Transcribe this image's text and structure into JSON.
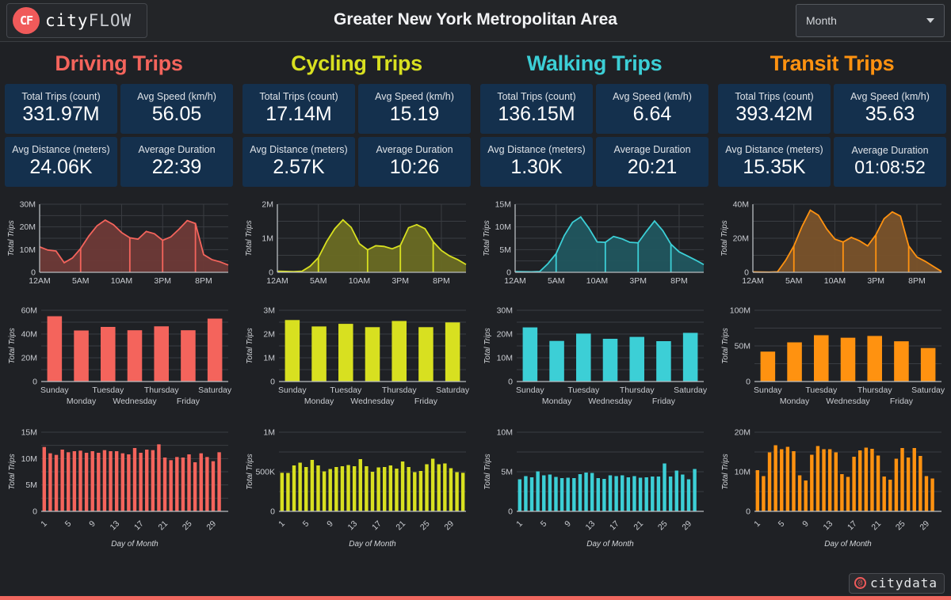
{
  "header": {
    "logo": {
      "badge": "CF",
      "text_part1": "city",
      "text_part2": "FLOW",
      "icon": "cityflow-logo-icon"
    },
    "title": "Greater New York Metropolitan Area",
    "period_selector": {
      "value": "Month",
      "icon": "chevron-down-icon"
    }
  },
  "footer": {
    "brand": "citydata",
    "icon": "at-circle-icon"
  },
  "columns": [
    {
      "title": "Driving Trips",
      "color": "#f4645c",
      "fill": "#6e3a37",
      "stats": [
        {
          "label": "Total Trips (count)",
          "value": "331.97M"
        },
        {
          "label": "Avg Speed (km/h)",
          "value": "56.05"
        },
        {
          "label": "Avg Distance (meters)",
          "value": "24.06K"
        },
        {
          "label": "Average Duration",
          "value": "22:39"
        }
      ]
    },
    {
      "title": "Cycling Trips",
      "color": "#d8e020",
      "fill": "#6a6c23",
      "stats": [
        {
          "label": "Total Trips (count)",
          "value": "17.14M"
        },
        {
          "label": "Avg Speed (km/h)",
          "value": "15.19"
        },
        {
          "label": "Avg Distance (meters)",
          "value": "2.57K"
        },
        {
          "label": "Average Duration",
          "value": "10:26"
        }
      ]
    },
    {
      "title": "Walking Trips",
      "color": "#3ccfd6",
      "fill": "#21565e",
      "stats": [
        {
          "label": "Total Trips (count)",
          "value": "136.15M"
        },
        {
          "label": "Avg Speed (km/h)",
          "value": "6.64"
        },
        {
          "label": "Avg Distance (meters)",
          "value": "1.30K"
        },
        {
          "label": "Average Duration",
          "value": "20:21"
        }
      ]
    },
    {
      "title": "Transit Trips",
      "color": "#ff9210",
      "fill": "#7a532a",
      "stats": [
        {
          "label": "Total Trips (count)",
          "value": "393.42M"
        },
        {
          "label": "Avg Speed (km/h)",
          "value": "35.63"
        },
        {
          "label": "Avg Distance (meters)",
          "value": "15.35K"
        },
        {
          "label": "Average Duration",
          "value": "01:08:52"
        }
      ]
    }
  ],
  "chart_data": [
    {
      "id": "driving-hourly",
      "type": "area",
      "title": "",
      "xlabel": "",
      "ylabel": "Total Trips",
      "grid": true,
      "color": "#f4645c",
      "fill": "#6e3a37",
      "x": [
        "12AM",
        "1AM",
        "2AM",
        "3AM",
        "4AM",
        "5AM",
        "6AM",
        "7AM",
        "8AM",
        "9AM",
        "10AM",
        "11AM",
        "12PM",
        "1PM",
        "2PM",
        "3PM",
        "4PM",
        "5PM",
        "6PM",
        "7PM",
        "8PM",
        "9PM",
        "10PM",
        "11PM"
      ],
      "xtick_labels": [
        "12AM",
        "5AM",
        "10AM",
        "3PM",
        "8PM"
      ],
      "xtick_indices": [
        0,
        5,
        10,
        15,
        20
      ],
      "ytick_labels": [
        "0",
        "10M",
        "20M",
        "30M"
      ],
      "ytick_values": [
        0,
        10000000,
        20000000,
        30000000
      ],
      "ylim": [
        0,
        30000000
      ],
      "values": [
        11200000,
        9800000,
        9400000,
        4200000,
        6300000,
        10500000,
        16000000,
        20500000,
        23000000,
        21000000,
        17500000,
        15200000,
        14600000,
        18000000,
        17000000,
        14100000,
        15600000,
        19000000,
        22800000,
        21500000,
        7800000,
        5600000,
        4600000,
        3200000
      ]
    },
    {
      "id": "cycling-hourly",
      "type": "area",
      "ylabel": "Total Trips",
      "grid": true,
      "color": "#d8e020",
      "fill": "#6a6c23",
      "x": [
        "12AM",
        "1AM",
        "2AM",
        "3AM",
        "4AM",
        "5AM",
        "6AM",
        "7AM",
        "8AM",
        "9AM",
        "10AM",
        "11AM",
        "12PM",
        "1PM",
        "2PM",
        "3PM",
        "4PM",
        "5PM",
        "6PM",
        "7PM",
        "8PM",
        "9PM",
        "10PM",
        "11PM"
      ],
      "xtick_labels": [
        "12AM",
        "5AM",
        "10AM",
        "3PM",
        "8PM"
      ],
      "xtick_indices": [
        0,
        5,
        10,
        15,
        20
      ],
      "ytick_labels": [
        "0",
        "1M",
        "2M"
      ],
      "ytick_values": [
        0,
        1000000,
        2000000
      ],
      "ylim": [
        0,
        2000000
      ],
      "values": [
        30000,
        25000,
        20000,
        30000,
        180000,
        430000,
        900000,
        1280000,
        1540000,
        1320000,
        840000,
        660000,
        780000,
        760000,
        690000,
        790000,
        1310000,
        1400000,
        1280000,
        900000,
        640000,
        480000,
        370000,
        230000
      ]
    },
    {
      "id": "walking-hourly",
      "type": "area",
      "ylabel": "Total Trips",
      "grid": true,
      "color": "#3ccfd6",
      "fill": "#21565e",
      "x": [
        "12AM",
        "1AM",
        "2AM",
        "3AM",
        "4AM",
        "5AM",
        "6AM",
        "7AM",
        "8AM",
        "9AM",
        "10AM",
        "11AM",
        "12PM",
        "1PM",
        "2PM",
        "3PM",
        "4PM",
        "5PM",
        "6PM",
        "7PM",
        "8PM",
        "9PM",
        "10PM",
        "11PM"
      ],
      "xtick_labels": [
        "12AM",
        "5AM",
        "10AM",
        "3PM",
        "8PM"
      ],
      "xtick_indices": [
        0,
        5,
        10,
        15,
        20
      ],
      "ytick_labels": [
        "0",
        "5M",
        "10M",
        "15M"
      ],
      "ytick_values": [
        0,
        5000000,
        10000000,
        15000000
      ],
      "ylim": [
        0,
        15000000
      ],
      "values": [
        150000,
        120000,
        100000,
        180000,
        1900000,
        4100000,
        8100000,
        11000000,
        12200000,
        9700000,
        6700000,
        6600000,
        7900000,
        7400000,
        6600000,
        6500000,
        9000000,
        11300000,
        9200000,
        6200000,
        4500000,
        3600000,
        2700000,
        1700000
      ]
    },
    {
      "id": "transit-hourly",
      "type": "area",
      "ylabel": "Total Trips",
      "grid": true,
      "color": "#ff9210",
      "fill": "#7a532a",
      "x": [
        "12AM",
        "1AM",
        "2AM",
        "3AM",
        "4AM",
        "5AM",
        "6AM",
        "7AM",
        "8AM",
        "9AM",
        "10AM",
        "11AM",
        "12PM",
        "1PM",
        "2PM",
        "3PM",
        "4PM",
        "5PM",
        "6PM",
        "7PM",
        "8PM",
        "9PM",
        "10PM",
        "11PM"
      ],
      "xtick_labels": [
        "12AM",
        "5AM",
        "10AM",
        "3PM",
        "8PM"
      ],
      "xtick_indices": [
        0,
        5,
        10,
        15,
        20
      ],
      "ytick_labels": [
        "0",
        "20M",
        "40M"
      ],
      "ytick_values": [
        0,
        20000000,
        40000000
      ],
      "ylim": [
        0,
        40000000
      ],
      "values": [
        200000,
        150000,
        130000,
        300000,
        7000000,
        15500000,
        27000000,
        36500000,
        33500000,
        25500000,
        19500000,
        17800000,
        20500000,
        18500000,
        15500000,
        22000000,
        31500000,
        35500000,
        33000000,
        15500000,
        9000000,
        6500000,
        3500000,
        500000
      ]
    },
    {
      "id": "driving-dow",
      "type": "bar",
      "ylabel": "Total Trips",
      "color": "#f4645c",
      "categories": [
        "Sunday",
        "Monday",
        "Tuesday",
        "Wednesday",
        "Thursday",
        "Friday",
        "Saturday"
      ],
      "values": [
        55000000,
        43000000,
        46000000,
        43200000,
        46500000,
        43200000,
        53000000
      ],
      "ytick_labels": [
        "0",
        "20M",
        "40M",
        "60M"
      ],
      "ytick_values": [
        0,
        20000000,
        40000000,
        60000000
      ],
      "ylim": [
        0,
        60000000
      ]
    },
    {
      "id": "cycling-dow",
      "type": "bar",
      "ylabel": "Total Trips",
      "color": "#d8e020",
      "categories": [
        "Sunday",
        "Monday",
        "Tuesday",
        "Wednesday",
        "Thursday",
        "Friday",
        "Saturday"
      ],
      "values": [
        2590000,
        2320000,
        2430000,
        2290000,
        2550000,
        2290000,
        2490000
      ],
      "ytick_labels": [
        "0",
        "1M",
        "2M",
        "3M"
      ],
      "ytick_values": [
        0,
        1000000,
        2000000,
        3000000
      ],
      "ylim": [
        0,
        3000000
      ]
    },
    {
      "id": "walking-dow",
      "type": "bar",
      "ylabel": "Total Trips",
      "color": "#3ccfd6",
      "categories": [
        "Sunday",
        "Monday",
        "Tuesday",
        "Wednesday",
        "Thursday",
        "Friday",
        "Saturday"
      ],
      "values": [
        22800000,
        17100000,
        20200000,
        18000000,
        18800000,
        17000000,
        20500000
      ],
      "ytick_labels": [
        "0",
        "10M",
        "20M",
        "30M"
      ],
      "ytick_values": [
        0,
        10000000,
        20000000,
        30000000
      ],
      "ylim": [
        0,
        30000000
      ]
    },
    {
      "id": "transit-dow",
      "type": "bar",
      "ylabel": "Total Trips",
      "color": "#ff9210",
      "categories": [
        "Sunday",
        "Monday",
        "Tuesday",
        "Wednesday",
        "Thursday",
        "Friday",
        "Saturday"
      ],
      "values": [
        42000000,
        55000000,
        65000000,
        61500000,
        64000000,
        56500000,
        47000000
      ],
      "ytick_labels": [
        "0",
        "50M",
        "100M"
      ],
      "ytick_values": [
        0,
        50000000,
        100000000
      ],
      "ylim": [
        0,
        100000000
      ]
    },
    {
      "id": "driving-dom",
      "type": "bar",
      "ylabel": "Total Trips",
      "xlabel": "Day of Month",
      "color": "#f4645c",
      "categories": [
        "1",
        "2",
        "3",
        "4",
        "5",
        "6",
        "7",
        "8",
        "9",
        "10",
        "11",
        "12",
        "13",
        "14",
        "15",
        "16",
        "17",
        "18",
        "19",
        "20",
        "21",
        "22",
        "23",
        "24",
        "25",
        "26",
        "27",
        "28",
        "29",
        "30",
        "31"
      ],
      "xtick_labels": [
        "1",
        "5",
        "9",
        "13",
        "17",
        "21",
        "25",
        "29"
      ],
      "values": [
        12200000,
        11000000,
        10700000,
        11700000,
        11200000,
        11400000,
        11500000,
        11100000,
        11400000,
        11100000,
        11600000,
        11400000,
        11400000,
        11000000,
        10800000,
        12000000,
        11100000,
        11700000,
        11600000,
        12700000,
        10200000,
        9700000,
        10300000,
        10200000,
        10800000,
        9300000,
        11000000,
        10300000,
        9500000,
        11200000,
        0
      ],
      "ytick_labels": [
        "0",
        "5M",
        "10M",
        "15M"
      ],
      "ytick_values": [
        0,
        5000000,
        10000000,
        15000000
      ],
      "ylim": [
        0,
        15000000
      ]
    },
    {
      "id": "cycling-dom",
      "type": "bar",
      "ylabel": "Total Trips",
      "xlabel": "Day of Month",
      "color": "#d8e020",
      "categories": [
        "1",
        "2",
        "3",
        "4",
        "5",
        "6",
        "7",
        "8",
        "9",
        "10",
        "11",
        "12",
        "13",
        "14",
        "15",
        "16",
        "17",
        "18",
        "19",
        "20",
        "21",
        "22",
        "23",
        "24",
        "25",
        "26",
        "27",
        "28",
        "29",
        "30",
        "31"
      ],
      "xtick_labels": [
        "1",
        "5",
        "9",
        "13",
        "17",
        "21",
        "25",
        "29"
      ],
      "values": [
        487000,
        485000,
        580000,
        615000,
        560000,
        650000,
        580000,
        505000,
        535000,
        560000,
        570000,
        585000,
        570000,
        660000,
        570000,
        500000,
        555000,
        560000,
        580000,
        540000,
        630000,
        560000,
        495000,
        510000,
        595000,
        665000,
        595000,
        605000,
        545000,
        495000,
        487000
      ],
      "ytick_labels": [
        "0",
        "500K",
        "1M"
      ],
      "ytick_values": [
        0,
        500000,
        1000000
      ],
      "ylim": [
        0,
        1000000
      ]
    },
    {
      "id": "walking-dom",
      "type": "bar",
      "ylabel": "Total Trips",
      "xlabel": "Day of Month",
      "color": "#3ccfd6",
      "categories": [
        "1",
        "2",
        "3",
        "4",
        "5",
        "6",
        "7",
        "8",
        "9",
        "10",
        "11",
        "12",
        "13",
        "14",
        "15",
        "16",
        "17",
        "18",
        "19",
        "20",
        "21",
        "22",
        "23",
        "24",
        "25",
        "26",
        "27",
        "28",
        "29",
        "30",
        "31"
      ],
      "xtick_labels": [
        "1",
        "5",
        "9",
        "13",
        "17",
        "21",
        "25",
        "29"
      ],
      "values": [
        4050000,
        4450000,
        4300000,
        5050000,
        4550000,
        4650000,
        4350000,
        4200000,
        4250000,
        4200000,
        4700000,
        4900000,
        4850000,
        4200000,
        4100000,
        4550000,
        4450000,
        4550000,
        4300000,
        4450000,
        4250000,
        4300000,
        4400000,
        4400000,
        6050000,
        4400000,
        5150000,
        4650000,
        4050000,
        5350000,
        0
      ],
      "ytick_labels": [
        "0",
        "5M",
        "10M"
      ],
      "ytick_values": [
        0,
        5000000,
        10000000
      ],
      "ylim": [
        0,
        10000000
      ]
    },
    {
      "id": "transit-dom",
      "type": "bar",
      "ylabel": "Total Trips",
      "xlabel": "Day of Month",
      "color": "#ff9210",
      "categories": [
        "1",
        "2",
        "3",
        "4",
        "5",
        "6",
        "7",
        "8",
        "9",
        "10",
        "11",
        "12",
        "13",
        "14",
        "15",
        "16",
        "17",
        "18",
        "19",
        "20",
        "21",
        "22",
        "23",
        "24",
        "25",
        "26",
        "27",
        "28",
        "29",
        "30",
        "31"
      ],
      "xtick_labels": [
        "1",
        "5",
        "9",
        "13",
        "17",
        "21",
        "25",
        "29"
      ],
      "values": [
        10400000,
        8900000,
        14900000,
        16700000,
        15700000,
        16300000,
        15200000,
        9100000,
        7800000,
        14300000,
        16500000,
        15700000,
        15700000,
        14900000,
        9400000,
        8700000,
        13800000,
        15400000,
        16100000,
        15800000,
        14100000,
        8800000,
        8000000,
        13300000,
        16000000,
        13600000,
        16000000,
        14000000,
        8900000,
        8300000,
        0
      ],
      "ytick_labels": [
        "0",
        "10M",
        "20M"
      ],
      "ytick_values": [
        0,
        10000000,
        20000000
      ],
      "ylim": [
        0,
        20000000
      ]
    }
  ]
}
